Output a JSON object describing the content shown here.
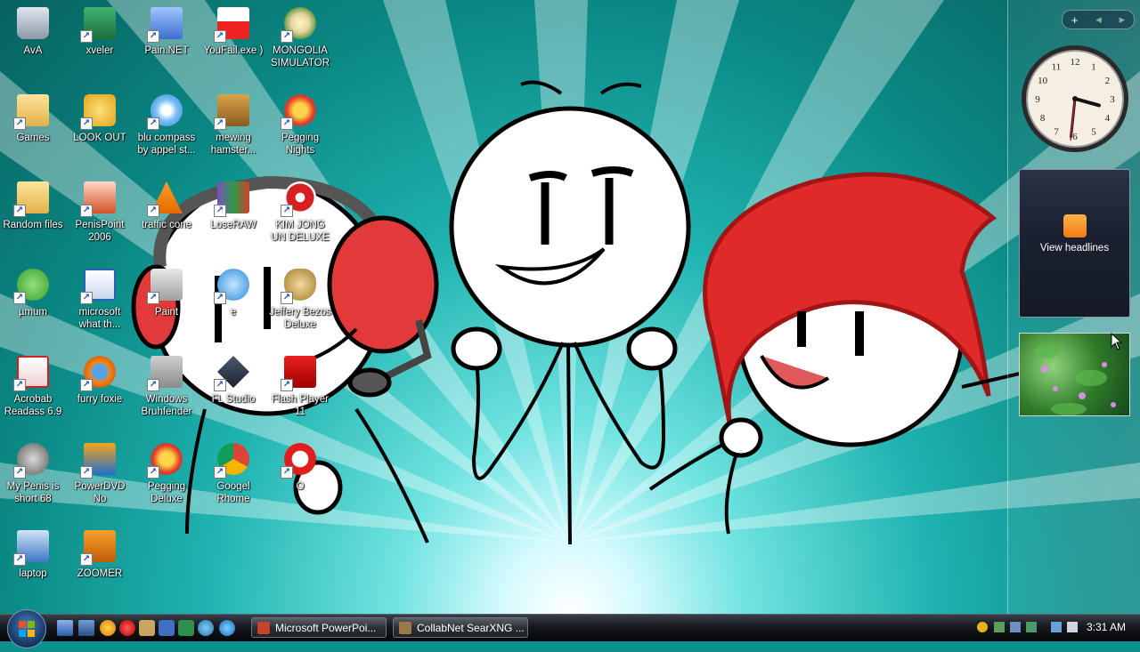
{
  "desktop": {
    "icons": [
      {
        "label": "AvA",
        "icon": "recycle-bin-icon"
      },
      {
        "label": "xveler",
        "icon": "excel-icon"
      },
      {
        "label": "Pain.NET",
        "icon": "paint-net-icon"
      },
      {
        "label": "YouFail.exe )",
        "icon": "youtube-exe-icon"
      },
      {
        "label": "MONGOLIA SIMULATOR",
        "icon": "flower-icon"
      },
      {
        "label": "Games",
        "icon": "folder-icon"
      },
      {
        "label": "LOOK OUT",
        "icon": "outlook-icon"
      },
      {
        "label": "blu compass by appel st...",
        "icon": "safari-icon"
      },
      {
        "label": "mewing hamster...",
        "icon": "hamster-box-icon"
      },
      {
        "label": "Pegging Nights",
        "icon": "pegging-p-icon"
      },
      {
        "label": "Random files",
        "icon": "folder-icon"
      },
      {
        "label": "PenisPoint 2006",
        "icon": "powerpoint-icon"
      },
      {
        "label": "traffic cone",
        "icon": "vlc-cone-icon"
      },
      {
        "label": "LoseRAW",
        "icon": "winrar-icon"
      },
      {
        "label": "KIM JONG UN DELUXE",
        "icon": "radiation-icon"
      },
      {
        "label": "µmum",
        "icon": "utorrent-icon"
      },
      {
        "label": "microsoft what th...",
        "icon": "word-icon"
      },
      {
        "label": "Paint",
        "icon": "paint-icon"
      },
      {
        "label": "e",
        "icon": "internet-explorer-icon"
      },
      {
        "label": "Jeffery Bezos Deluxe",
        "icon": "money-bag-icon"
      },
      {
        "label": "Acrobab Readass 6.9",
        "icon": "acrobat-icon"
      },
      {
        "label": "furry foxie",
        "icon": "firefox-icon"
      },
      {
        "label": "Windows Bruhfender",
        "icon": "windows-defender-icon"
      },
      {
        "label": "FL Studio",
        "icon": "fl-studio-icon"
      },
      {
        "label": "Flash Player 11",
        "icon": "flash-icon"
      },
      {
        "label": "My Penis is short 68",
        "icon": "raccoon-icon"
      },
      {
        "label": "PowerDVD No",
        "icon": "powerdvd-icon"
      },
      {
        "label": "Pegging Deluxe",
        "icon": "pegging-p-icon"
      },
      {
        "label": "Googel Rhome",
        "icon": "chrome-icon"
      },
      {
        "label": "O",
        "icon": "opera-icon"
      },
      {
        "label": "laptop",
        "icon": "laptop-icon"
      },
      {
        "label": "ZOOMER",
        "icon": "zoomer-icon"
      }
    ]
  },
  "sidebar": {
    "add_label": "+",
    "prev_label": "◂",
    "next_label": "▸",
    "clock": {
      "hour": 3,
      "minute": 31,
      "second": 31
    },
    "feed": {
      "label": "View headlines"
    }
  },
  "taskbar": {
    "tasks": [
      {
        "label": "Microsoft PowerPoi...",
        "icon": "powerpoint-icon",
        "color": "#c8432b"
      },
      {
        "label": "CollabNet SearXNG ...",
        "icon": "collabnet-icon",
        "color": "#9a7a4a"
      }
    ],
    "time": "3:31 AM"
  },
  "colors": {
    "accent": "#0d8f8c",
    "taskbar": "#15181d"
  }
}
